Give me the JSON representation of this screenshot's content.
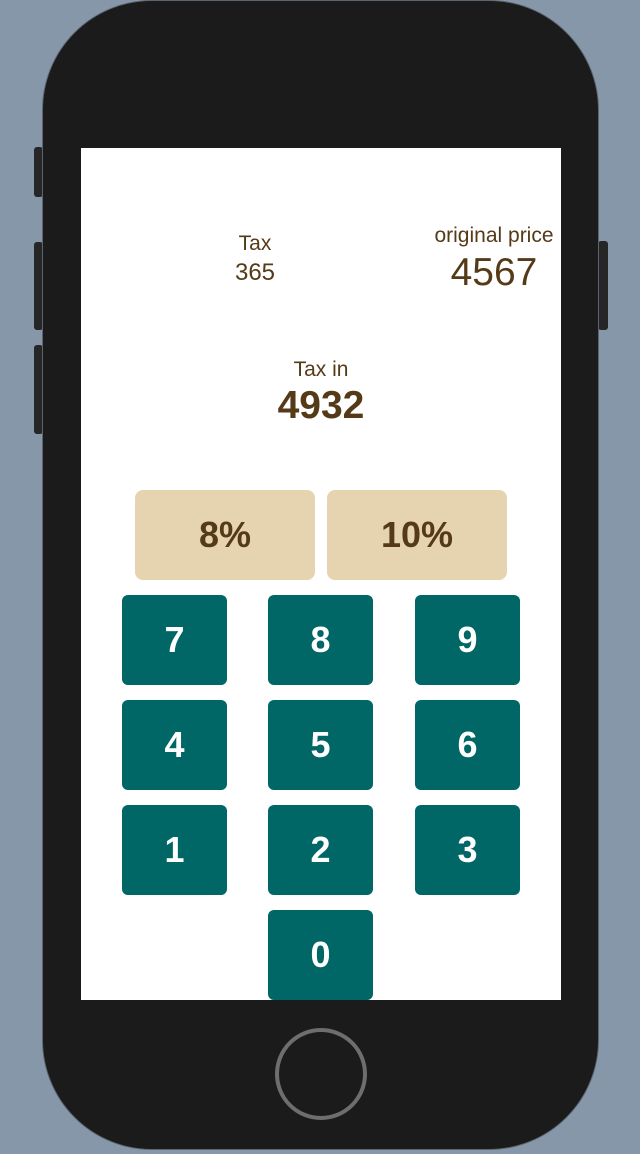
{
  "tax": {
    "label": "Tax",
    "value": "365"
  },
  "original_price": {
    "label": "original price",
    "value": "4567"
  },
  "tax_in": {
    "label": "Tax in",
    "value": "4932"
  },
  "rates": [
    "8%",
    "10%"
  ],
  "keys": [
    "7",
    "8",
    "9",
    "4",
    "5",
    "6",
    "1",
    "2",
    "3",
    "0"
  ],
  "colors": {
    "text": "#553a17",
    "rate_button": "#e6d3b0",
    "key": "#006666"
  }
}
